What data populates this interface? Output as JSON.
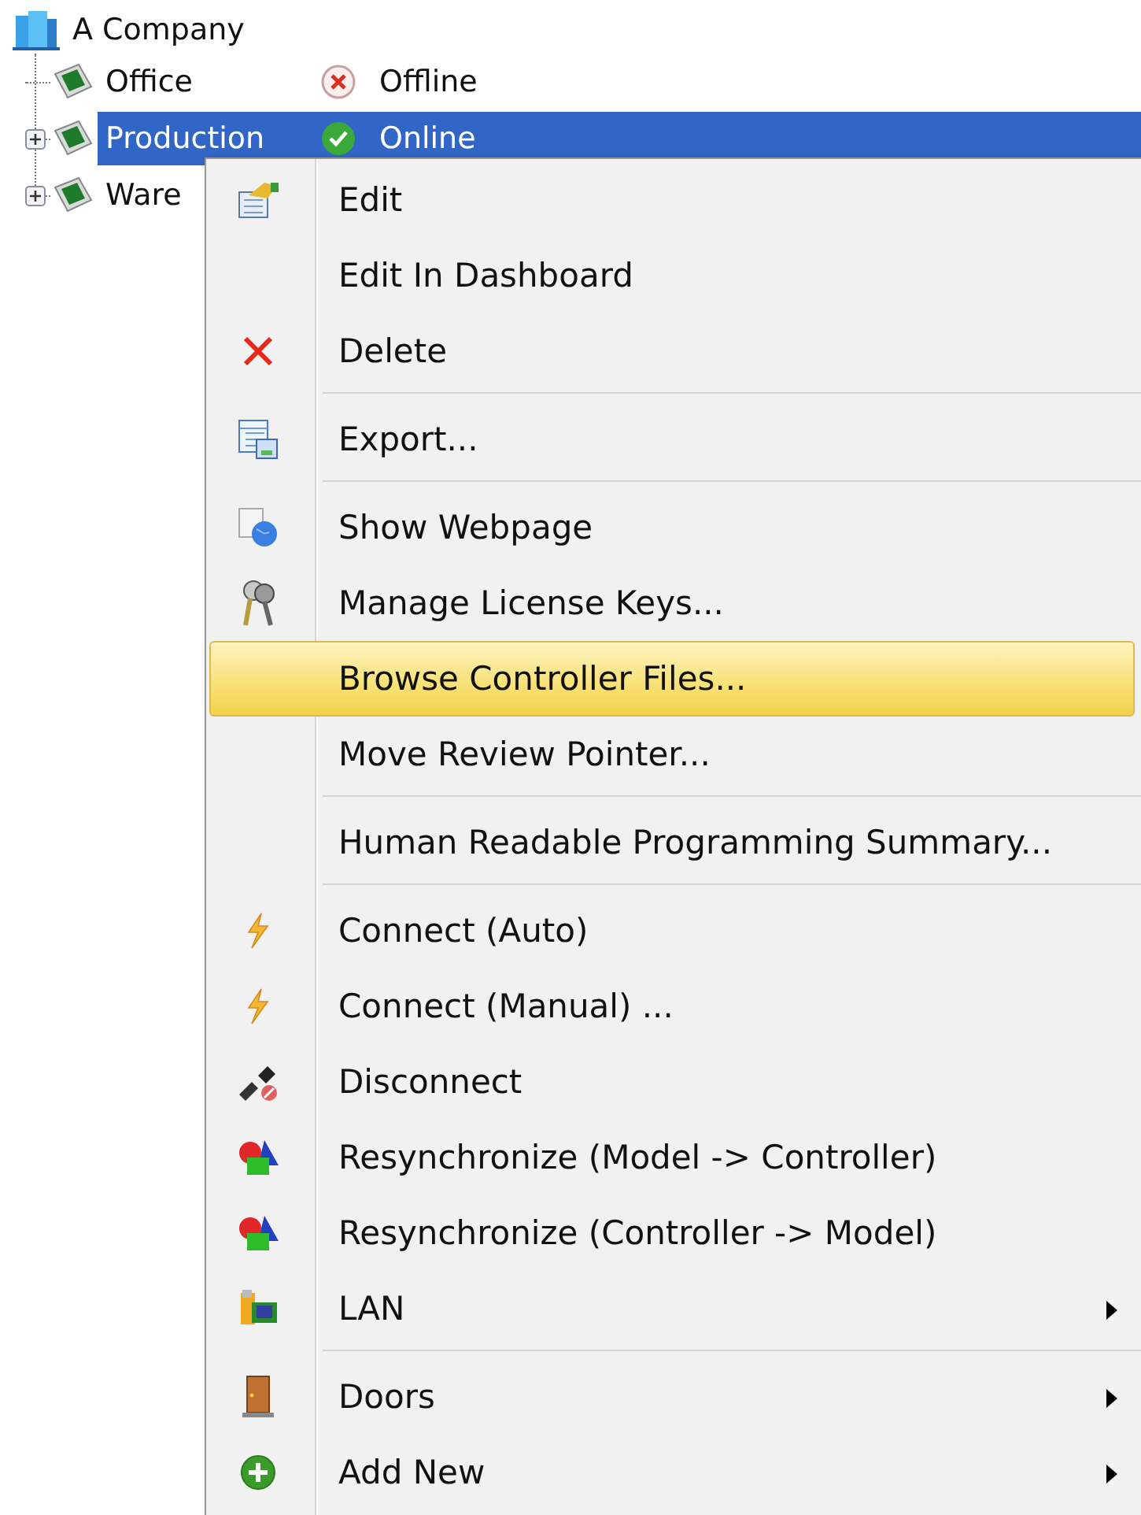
{
  "tree": {
    "root": {
      "label": "A Company",
      "children": [
        {
          "label": "Office",
          "has_children": false,
          "selected": false,
          "status": {
            "kind": "offline",
            "text": "Offline"
          }
        },
        {
          "label": "Production",
          "has_children": true,
          "selected": true,
          "status": {
            "kind": "online",
            "text": "Online"
          }
        },
        {
          "label": "Ware",
          "has_children": true,
          "selected": false
        }
      ]
    }
  },
  "context_menu": {
    "items": [
      {
        "kind": "item",
        "label": "Edit",
        "selected": false,
        "submenu": false
      },
      {
        "kind": "item",
        "label": "Edit In Dashboard",
        "selected": false,
        "submenu": false
      },
      {
        "kind": "item",
        "label": "Delete",
        "selected": false,
        "submenu": false
      },
      {
        "kind": "separator"
      },
      {
        "kind": "item",
        "label": "Export...",
        "selected": false,
        "submenu": false
      },
      {
        "kind": "separator"
      },
      {
        "kind": "item",
        "label": "Show Webpage",
        "selected": false,
        "submenu": false
      },
      {
        "kind": "item",
        "label": "Manage License Keys...",
        "selected": false,
        "submenu": false
      },
      {
        "kind": "item",
        "label": "Browse Controller Files...",
        "selected": true,
        "submenu": false
      },
      {
        "kind": "item",
        "label": "Move Review Pointer...",
        "selected": false,
        "submenu": false
      },
      {
        "kind": "separator"
      },
      {
        "kind": "item",
        "label": "Human Readable Programming Summary...",
        "selected": false,
        "submenu": false
      },
      {
        "kind": "separator"
      },
      {
        "kind": "item",
        "label": "Connect (Auto)",
        "selected": false,
        "submenu": false
      },
      {
        "kind": "item",
        "label": "Connect (Manual) ...",
        "selected": false,
        "submenu": false
      },
      {
        "kind": "item",
        "label": "Disconnect",
        "selected": false,
        "submenu": false
      },
      {
        "kind": "item",
        "label": "Resynchronize (Model -> Controller)",
        "selected": false,
        "submenu": false
      },
      {
        "kind": "item",
        "label": "Resynchronize (Controller -> Model)",
        "selected": false,
        "submenu": false
      },
      {
        "kind": "item",
        "label": "LAN",
        "selected": false,
        "submenu": true
      },
      {
        "kind": "separator"
      },
      {
        "kind": "item",
        "label": "Doors",
        "selected": false,
        "submenu": true
      },
      {
        "kind": "item",
        "label": "Add New",
        "selected": false,
        "submenu": true
      }
    ]
  }
}
